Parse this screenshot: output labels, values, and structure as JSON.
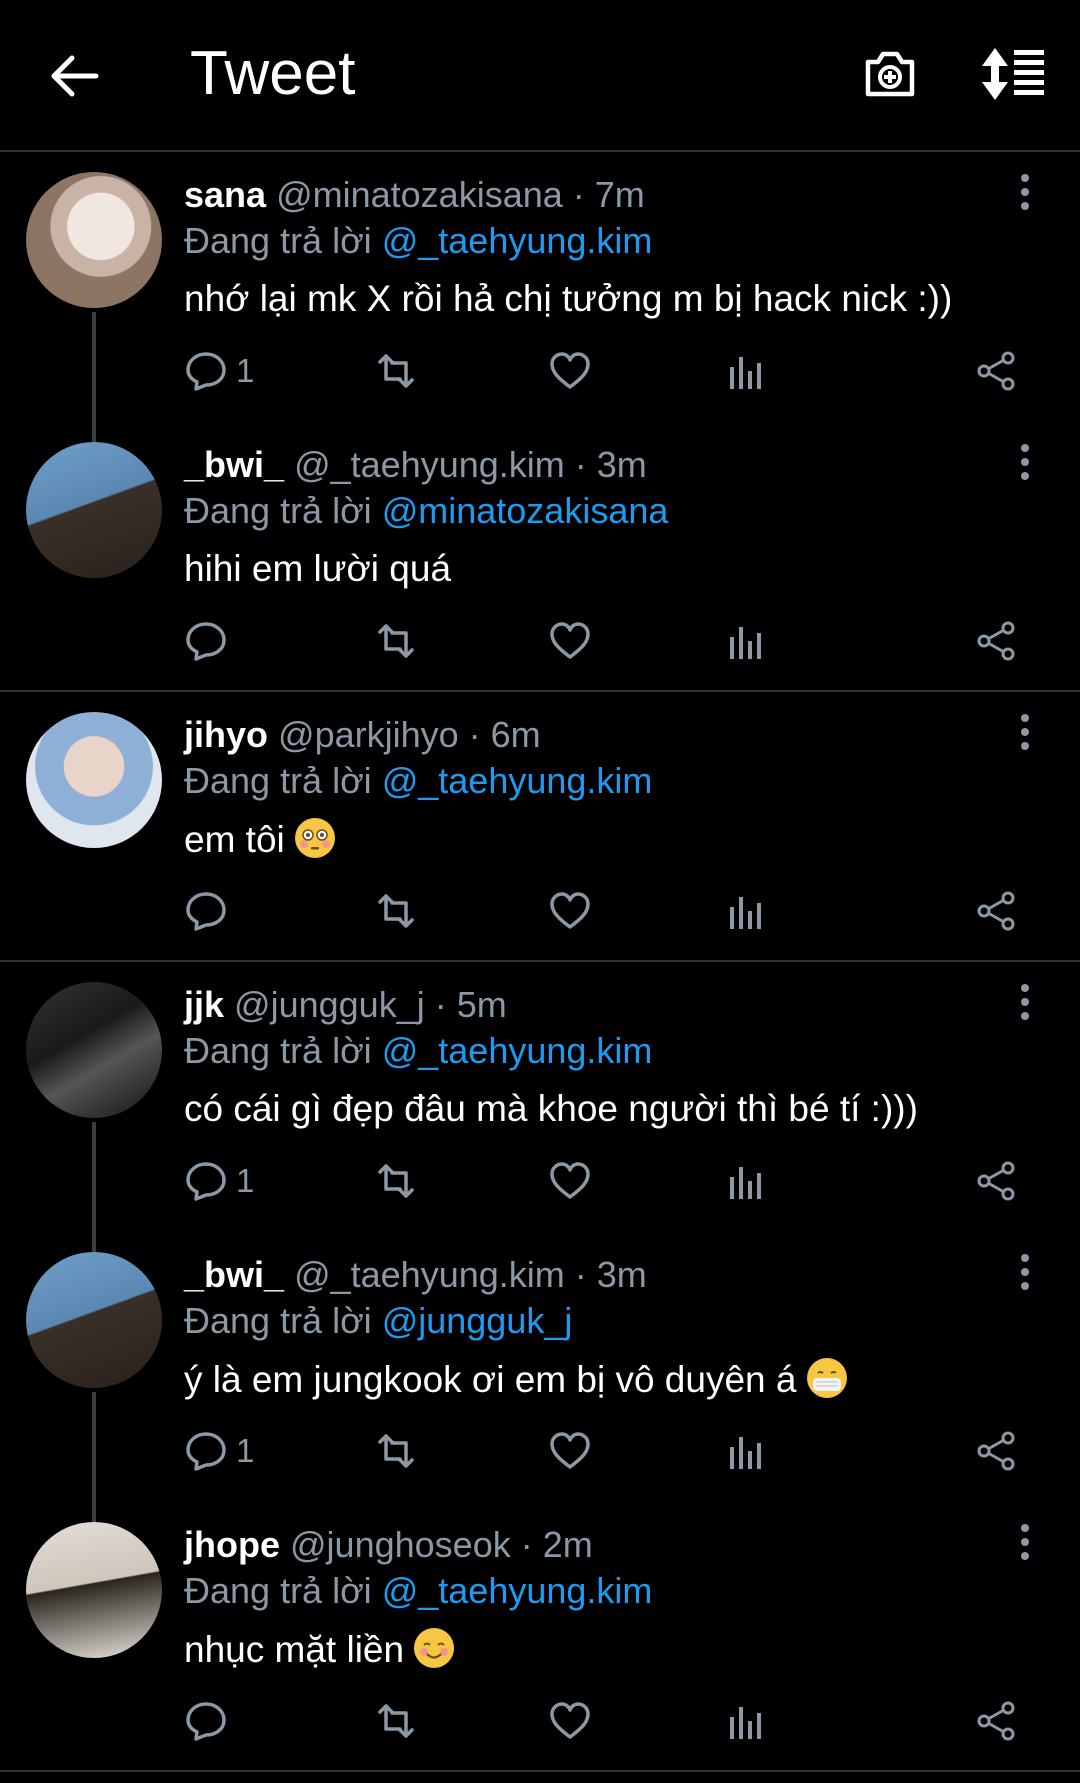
{
  "header": {
    "title": "Tweet",
    "back_icon": "arrow-left-icon",
    "camera_icon": "camera-add-icon",
    "sort_icon": "sort-icon"
  },
  "colors": {
    "background": "#000000",
    "link": "#1d9bf0",
    "muted": "#8b98a5",
    "divider": "#2f3336"
  },
  "reply_prefix": "Đang trả lời",
  "tweets": [
    {
      "name": "sana",
      "handle": "@minatozakisana",
      "time": "· 7m",
      "reply_to": "@_taehyung.kim",
      "text": "nhớ lại mk X rồi hả chị tưởng m bị hack nick :))",
      "reply_count": "1"
    },
    {
      "name": "_bwi_",
      "handle": "@_taehyung.kim",
      "time": "· 3m",
      "reply_to": "@minatozakisana",
      "text": "hihi em lười quá",
      "reply_count": ""
    },
    {
      "name": "jihyo",
      "handle": "@parkjihyo",
      "time": "· 6m",
      "reply_to": "@_taehyung.kim",
      "text": "em tôi",
      "emoji": "flushed-face-emoji",
      "reply_count": ""
    },
    {
      "name": "jjk",
      "handle": "@jungguk_j",
      "time": "· 5m",
      "reply_to": "@_taehyung.kim",
      "text": "có cái gì đẹp đâu mà khoe người thì bé tí :)))",
      "reply_count": "1"
    },
    {
      "name": "_bwi_",
      "handle": "@_taehyung.kim",
      "time": "· 3m",
      "reply_to": "@jungguk_j",
      "text": "ý là em jungkook ơi em bị vô duyên á",
      "emoji": "mask-face-emoji",
      "reply_count": "1"
    },
    {
      "name": "jhope",
      "handle": "@junghoseok",
      "time": "· 2m",
      "reply_to": "@_taehyung.kim",
      "text": "nhục mặt liền",
      "emoji": "smiling-blush-emoji",
      "reply_count": ""
    }
  ]
}
